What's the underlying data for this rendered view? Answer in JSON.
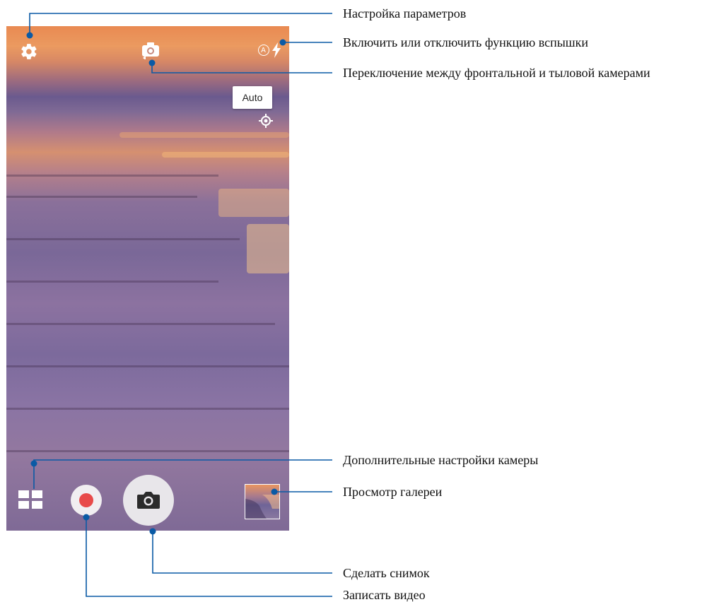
{
  "camera": {
    "flash_mode_badge": "A",
    "auto_chip": "Auto",
    "colors": {
      "leader_line": "#0a5aa5",
      "record_dot": "#e84a4a",
      "shutter_bg": "#e8e6ea"
    },
    "icons": {
      "settings": "gear-icon",
      "switch_camera": "camera-switch-icon",
      "flash": "flash-auto-icon",
      "focus": "focus-target-icon",
      "modes": "grid-modes-icon",
      "record": "record-icon",
      "shutter": "camera-icon",
      "gallery": "gallery-thumbnail"
    }
  },
  "callouts": {
    "settings": "Настройка параметров",
    "flash": "Включить или отключить функцию вспышки",
    "switch_camera": "Переключение между фронтальной и тыловой камерами",
    "advanced": "Дополнительные настройки камеры",
    "gallery": "Просмотр галереи",
    "take_photo": "Сделать снимок",
    "record_video": "Записать видео"
  }
}
